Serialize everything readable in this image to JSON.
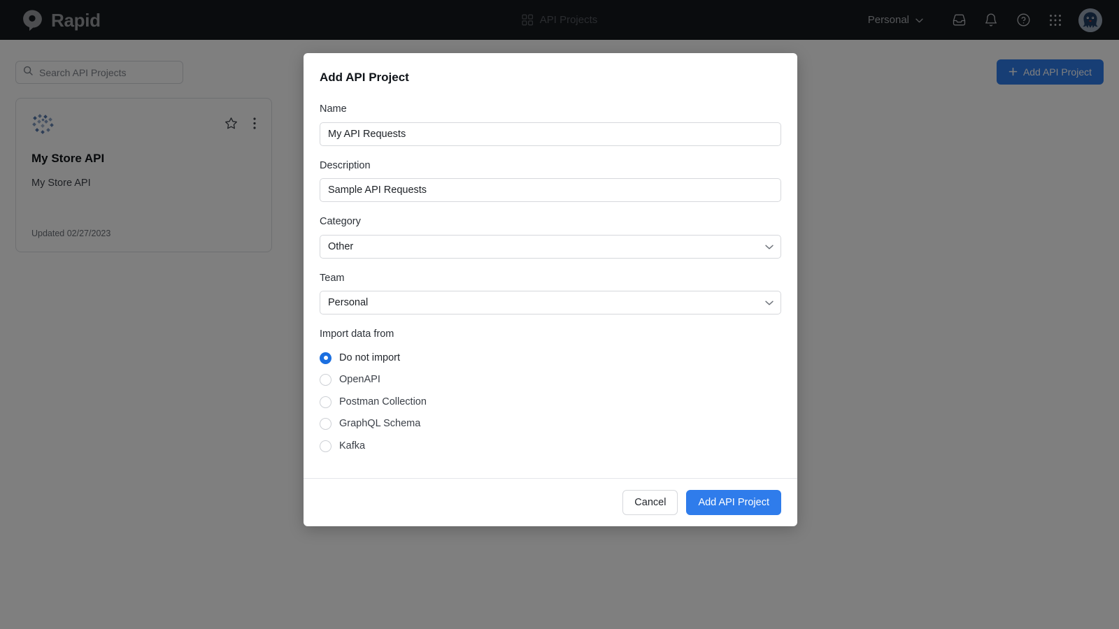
{
  "brand": {
    "name": "Rapid",
    "logo_icon": "rapid-logo-icon"
  },
  "topnav": {
    "center_label": "API Projects",
    "center_icon": "grid-squares-icon",
    "team_label": "Personal",
    "team_chevron_icon": "chevron-down-icon",
    "inbox_icon": "inbox-icon",
    "notifications_icon": "bell-icon",
    "help_icon": "help-circle-icon",
    "apps_icon": "apps-grid-icon",
    "avatar_icon": "user-avatar-octopus"
  },
  "page": {
    "search": {
      "placeholder": "Search API Projects",
      "value": "",
      "icon": "search-icon"
    },
    "add_project_button": {
      "label": "Add API Project",
      "icon": "plus-icon",
      "color": "#2f7ceb"
    },
    "cards": [
      {
        "logo_icon": "project-logo-icon",
        "title": "My Store API",
        "description": "My Store API",
        "updated": "Updated 02/27/2023",
        "favorite_icon": "star-outline-icon",
        "menu_icon": "kebab-menu-icon"
      }
    ]
  },
  "modal": {
    "title": "Add API Project",
    "fields": {
      "name": {
        "label": "Name",
        "value": "My API Requests"
      },
      "description": {
        "label": "Description",
        "value": "Sample API Requests"
      },
      "category": {
        "label": "Category",
        "value": "Other",
        "chevron_icon": "chevron-down-icon"
      },
      "team": {
        "label": "Team",
        "value": "Personal",
        "chevron_icon": "chevron-down-icon"
      }
    },
    "import": {
      "label": "Import data from",
      "selected": "Do not import",
      "options": [
        {
          "label": "Do not import",
          "checked": true
        },
        {
          "label": "OpenAPI",
          "checked": false
        },
        {
          "label": "Postman Collection",
          "checked": false
        },
        {
          "label": "GraphQL Schema",
          "checked": false
        },
        {
          "label": "Kafka",
          "checked": false
        }
      ]
    },
    "footer": {
      "cancel_label": "Cancel",
      "submit_label": "Add API Project",
      "submit_color": "#2f7ceb"
    }
  }
}
